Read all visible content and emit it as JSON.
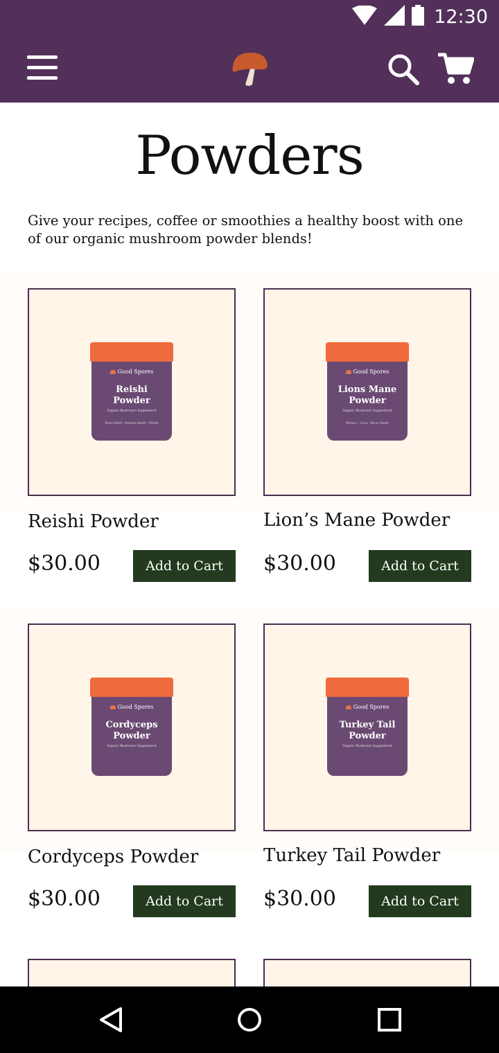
{
  "status_bar": {
    "time": "12:30",
    "icons": [
      "wifi-icon",
      "signal-icon",
      "battery-icon"
    ]
  },
  "app_bar": {
    "icons": [
      "menu-icon",
      "mushroom-logo",
      "search-icon",
      "cart-icon"
    ]
  },
  "page": {
    "title": "Powders",
    "intro": "Give your recipes, coffee or smoothies a healthy boost with one of our organic mushroom powder blends!"
  },
  "products": [
    {
      "name": "Reishi Powder",
      "price": "$30.00",
      "button": "Add to Cart"
    },
    {
      "name": "Lion’s Mane Powder",
      "price": "$30.00",
      "button": "Add to Cart"
    },
    {
      "name": "Cordyceps Powder",
      "price": "$30.00",
      "button": "Add to Cart"
    },
    {
      "name": "Turkey Tail Powder",
      "price": "$30.00",
      "button": "Add to Cart"
    }
  ],
  "jars": [
    {
      "brand": "Good Spores",
      "line1": "Reishi",
      "line2": "Powder",
      "sub": "Organic Mushroom Supplement",
      "tags": "Stress Relief · Immune Health · Vitality"
    },
    {
      "brand": "Good Spores",
      "line1": "Lions Mane",
      "line2": "Powder",
      "sub": "Organic Mushroom Supplement",
      "tags": "Memory · Focus · Nerve Health"
    },
    {
      "brand": "Good Spores",
      "line1": "Cordyceps",
      "line2": "Powder",
      "sub": "Organic Mushroom Supplement",
      "tags": ""
    },
    {
      "brand": "Good Spores",
      "line1": "Turkey Tail",
      "line2": "Powder",
      "sub": "Organic Mushroom Supplement",
      "tags": ""
    }
  ],
  "nav_bar": {
    "icons": [
      "back-icon",
      "home-icon",
      "recents-icon"
    ]
  },
  "colors": {
    "brand_purple": "#52305a",
    "button_green": "#233a1e",
    "image_bg": "#fff5e8",
    "jar_lid": "#ef6a3c",
    "jar_body": "#6a4a72"
  }
}
